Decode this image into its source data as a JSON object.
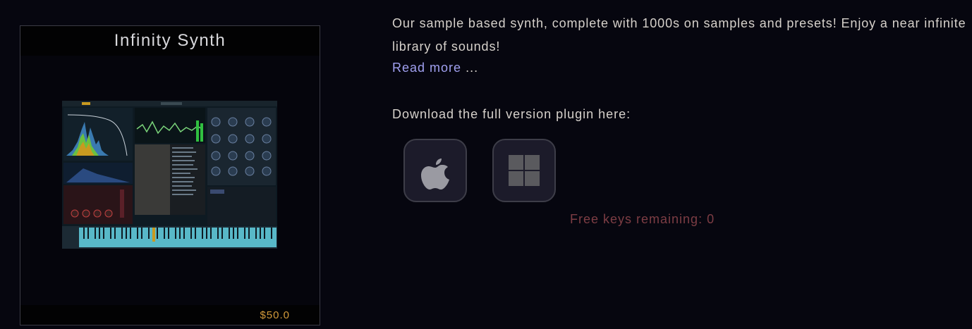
{
  "product": {
    "title": "Infinity Synth",
    "price": "$50.0",
    "image_icon": "plugin-screenshot"
  },
  "description": {
    "text": "Our sample based synth, complete with 1000s on samples and presets! Enjoy a near infinite library of sounds!",
    "read_more_label": "Read more",
    "read_more_suffix": "..."
  },
  "download": {
    "label": "Download the full version plugin here:",
    "buttons": [
      {
        "platform": "mac",
        "icon": "apple-icon"
      },
      {
        "platform": "windows",
        "icon": "windows-icon"
      }
    ]
  },
  "keys": {
    "text": "Free keys remaining: 0"
  },
  "colors": {
    "background": "#06060f",
    "price": "#d39a3a",
    "link": "#a0a0f0",
    "free_keys": "#7d3d44"
  }
}
